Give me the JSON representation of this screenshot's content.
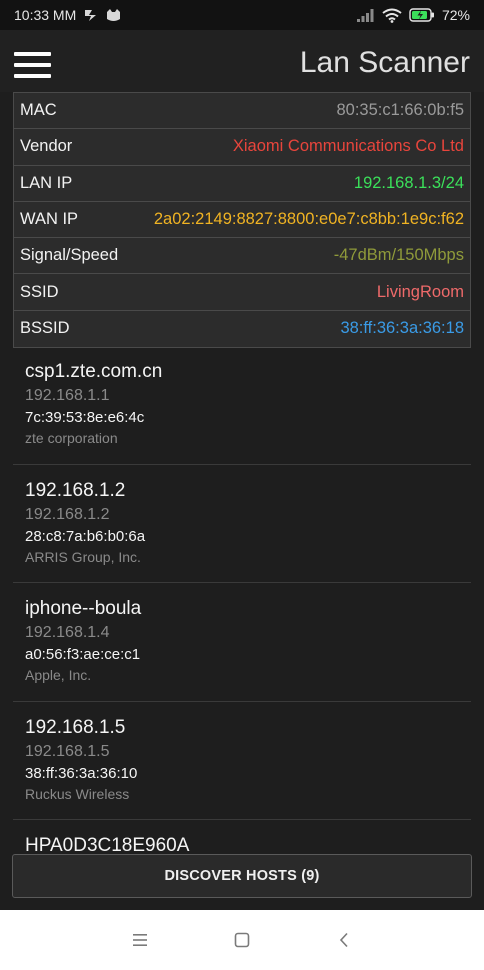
{
  "status_bar": {
    "time": "10:33 MM",
    "battery": "72%"
  },
  "app_bar": {
    "title": "Lan Scanner"
  },
  "info": [
    {
      "label": "MAC",
      "value": "80:35:c1:66:0b:f5",
      "color": "#9a9a9a"
    },
    {
      "label": "Vendor",
      "value": "Xiaomi Communications Co Ltd",
      "color": "#e8453c"
    },
    {
      "label": "LAN IP",
      "value": "192.168.1.3/24",
      "color": "#3be05a"
    },
    {
      "label": "WAN IP",
      "value": "2a02:2149:8827:8800:e0e7:c8bb:1e9c:f62",
      "color": "#f0b323"
    },
    {
      "label": "Signal/Speed",
      "value": "-47dBm/150Mbps",
      "color": "#8f9a3a"
    },
    {
      "label": "SSID",
      "value": "LivingRoom",
      "color": "#ef6a6a"
    },
    {
      "label": "BSSID",
      "value": "38:ff:36:3a:36:18",
      "color": "#3a9be6"
    }
  ],
  "hosts": [
    {
      "name": "csp1.zte.com.cn",
      "ip": "192.168.1.1",
      "mac": "7c:39:53:8e:e6:4c",
      "vendor": "zte corporation"
    },
    {
      "name": "192.168.1.2",
      "ip": "192.168.1.2",
      "mac": "28:c8:7a:b6:b0:6a",
      "vendor": "ARRIS Group, Inc."
    },
    {
      "name": "iphone--boula",
      "ip": "192.168.1.4",
      "mac": "a0:56:f3:ae:ce:c1",
      "vendor": "Apple, Inc."
    },
    {
      "name": "192.168.1.5",
      "ip": "192.168.1.5",
      "mac": "38:ff:36:3a:36:10",
      "vendor": "Ruckus Wireless"
    },
    {
      "name": "HPA0D3C18E960A",
      "ip": "",
      "mac": "",
      "vendor": ""
    }
  ],
  "discover_button": {
    "label": "DISCOVER HOSTS (9)"
  },
  "icons": {
    "status_left": [
      "notification-icon",
      "cat-icon"
    ],
    "status_right": [
      "signal-icon",
      "wifi-icon",
      "battery-icon"
    ],
    "nav": [
      "recents-icon",
      "home-icon",
      "back-icon"
    ]
  }
}
